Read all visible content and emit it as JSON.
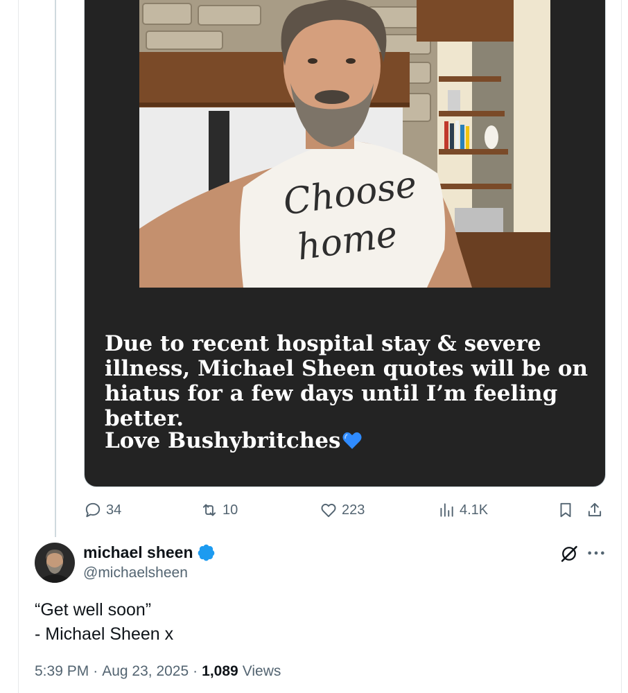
{
  "quoted_post": {
    "image_text": {
      "body": "Due to recent hospital stay & severe illness, Michael Sheen quotes will be on hiatus for a few days until I’m feeling better.",
      "signoff": "Love Bushybritches",
      "shirt_text": "Choose home"
    },
    "actions": {
      "replies": "34",
      "reposts": "10",
      "likes": "223",
      "views": "4.1K"
    }
  },
  "reply": {
    "author_name": "michael sheen",
    "handle": "@michaelsheen",
    "text_lines": [
      "“Get well soon”",
      "- Michael Sheen x"
    ],
    "time": "5:39 PM",
    "date": "Aug 23, 2025",
    "views_count": "1,089",
    "views_label": "Views",
    "separator": "·"
  },
  "colors": {
    "verified": "#1d9bf0",
    "muted": "#536471",
    "card_background": "#232323"
  }
}
